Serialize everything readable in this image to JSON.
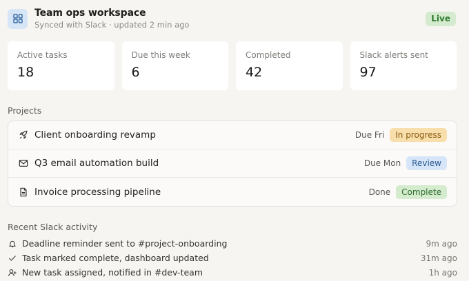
{
  "header": {
    "icon": "grid-icon",
    "title": "Team ops workspace",
    "subtitle": "Synced with Slack · updated 2 min ago",
    "status_badge": "Live"
  },
  "stats": [
    {
      "label": "Active tasks",
      "value": "18"
    },
    {
      "label": "Due this week",
      "value": "6"
    },
    {
      "label": "Completed",
      "value": "42"
    },
    {
      "label": "Slack alerts sent",
      "value": "97"
    }
  ],
  "projects": {
    "title": "Projects",
    "items": [
      {
        "icon": "rocket-icon",
        "name": "Client onboarding revamp",
        "due": "Due Fri",
        "status": "In progress"
      },
      {
        "icon": "mail-icon",
        "name": "Q3 email automation build",
        "due": "Due Mon",
        "status": "Review"
      },
      {
        "icon": "document-icon",
        "name": "Invoice processing pipeline",
        "due": "Done",
        "status": "Complete"
      }
    ]
  },
  "activity": {
    "title": "Recent Slack activity",
    "items": [
      {
        "icon": "bell-icon",
        "text": "Deadline reminder sent to #project-onboarding",
        "time": "9m ago"
      },
      {
        "icon": "check-icon",
        "text": "Task marked complete, dashboard updated",
        "time": "31m ago"
      },
      {
        "icon": "user-plus-icon",
        "text": "New task assigned, notified in #dev-team",
        "time": "1h ago"
      }
    ]
  },
  "colors": {
    "background": "#f6f5f2",
    "live": "#d5ebcf",
    "in_progress": "#f7deaa",
    "review": "#d6e6f8",
    "complete": "#d4ebce"
  }
}
